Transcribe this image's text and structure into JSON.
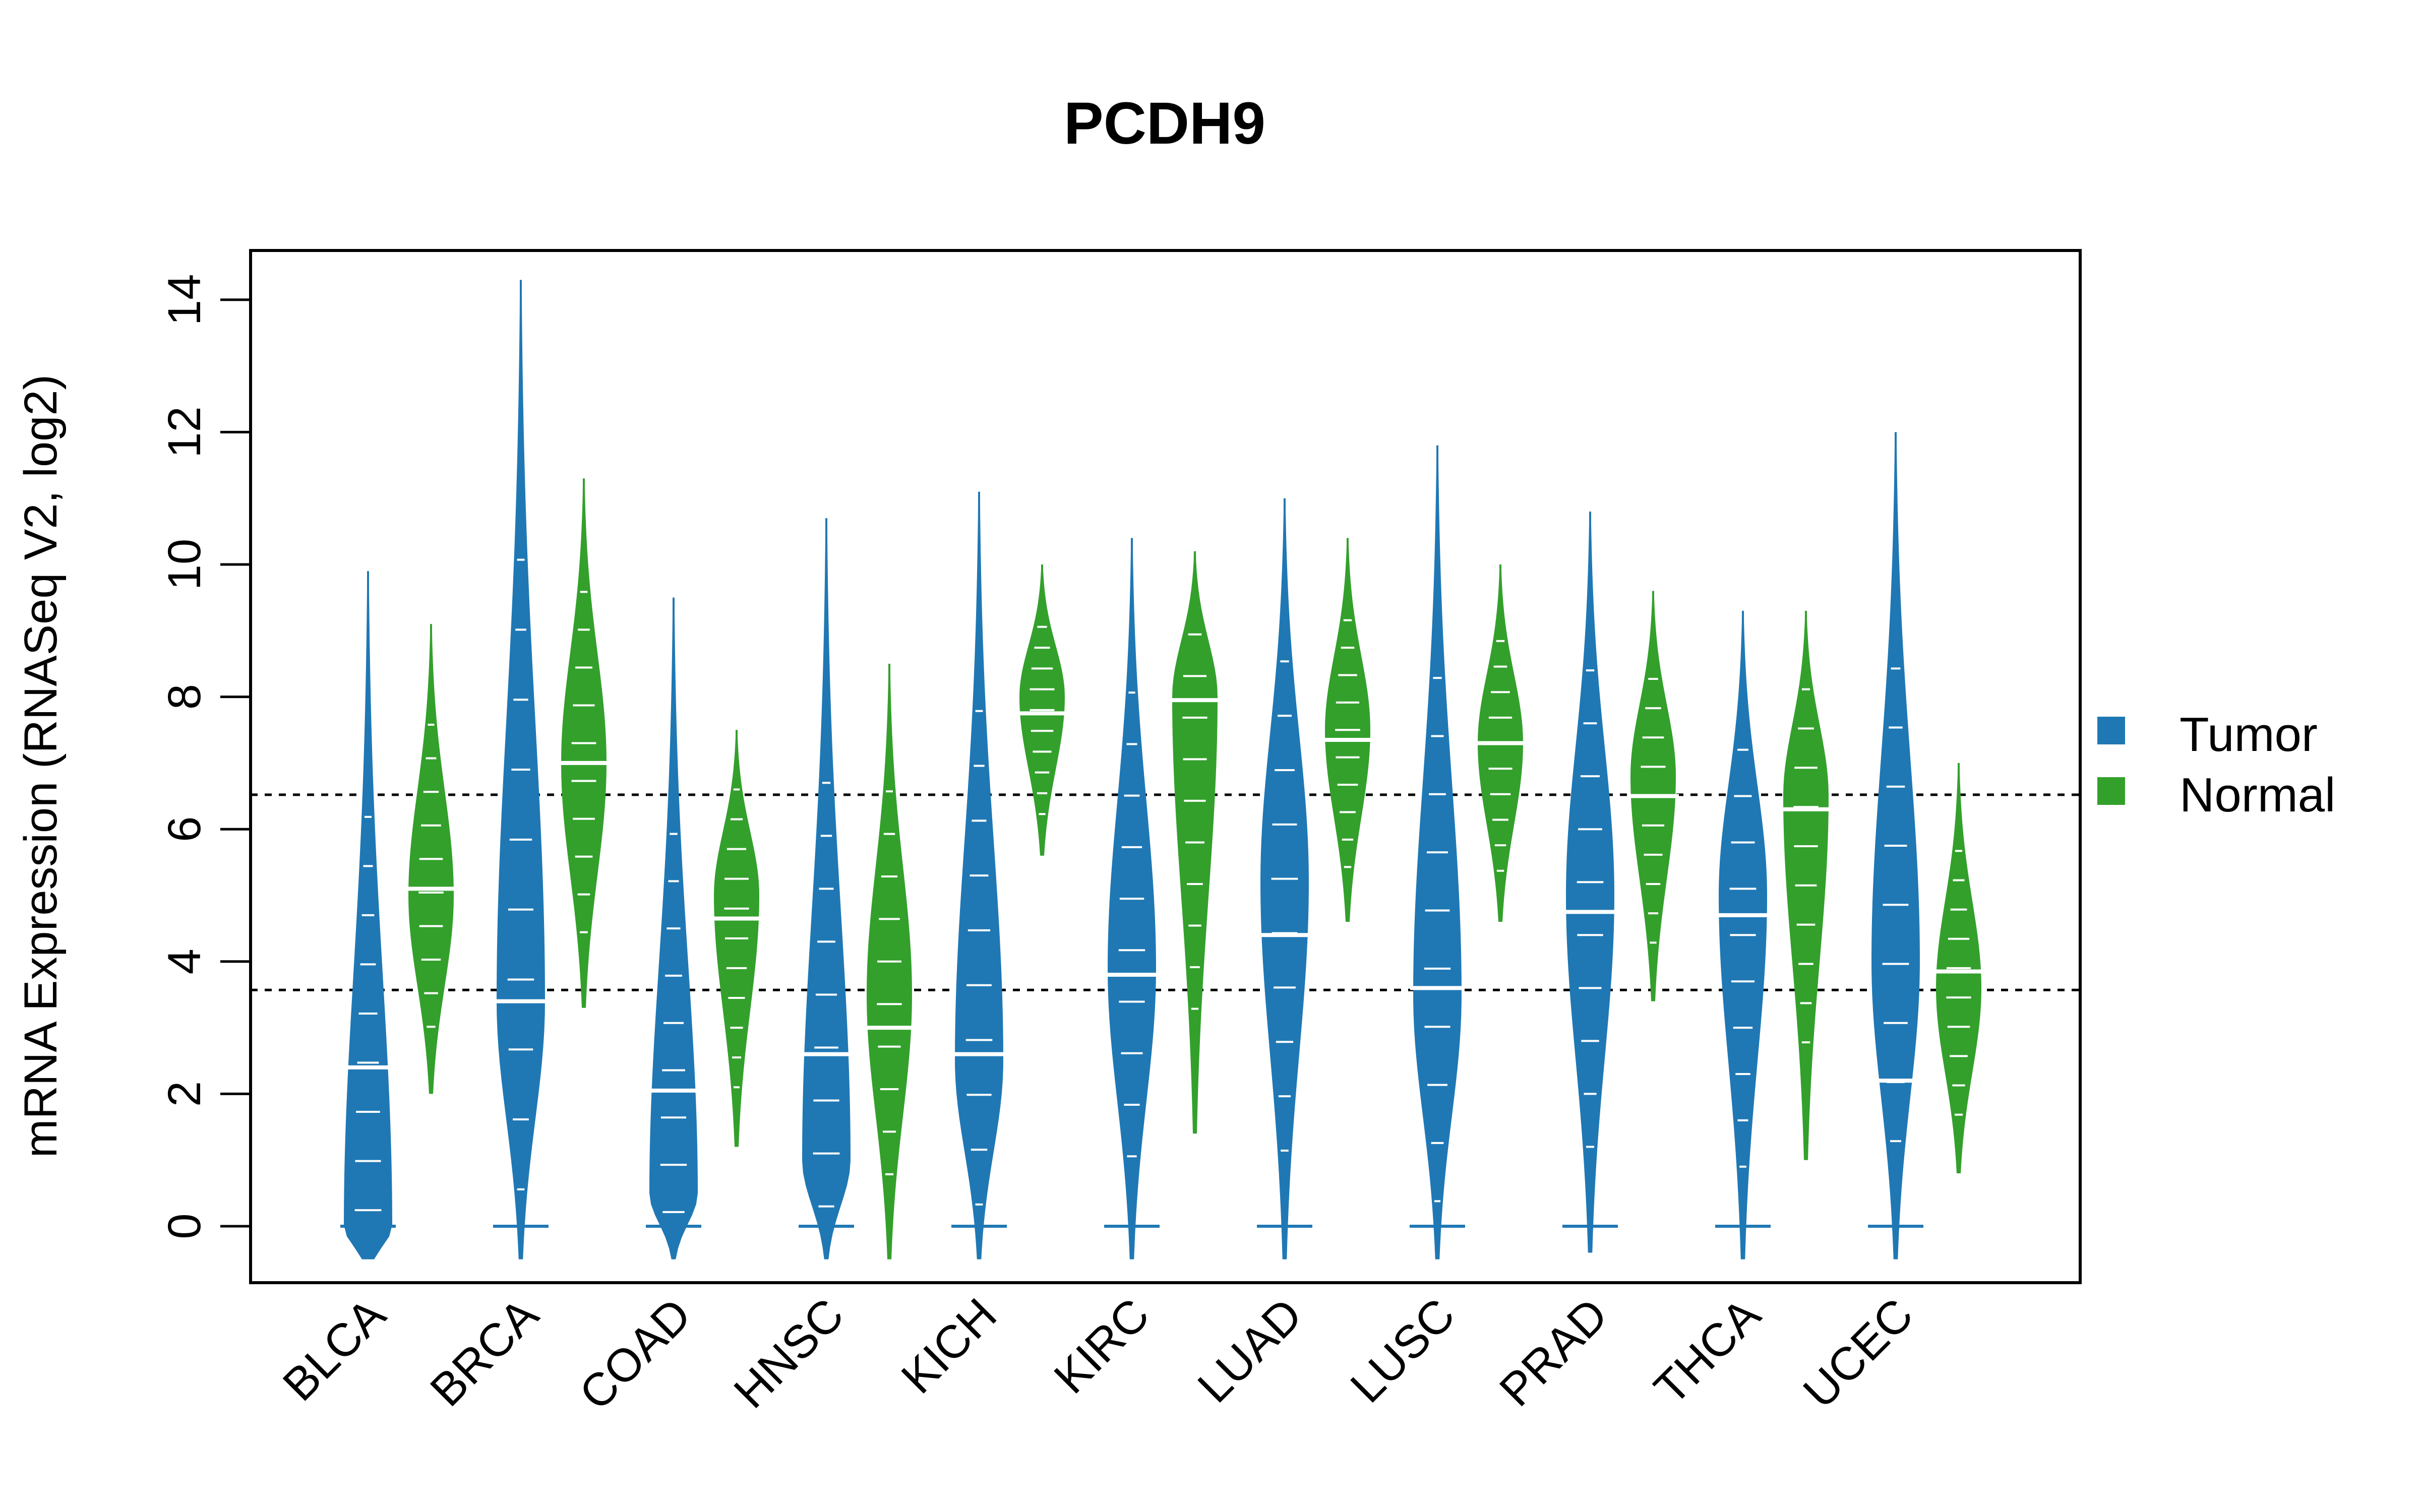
{
  "chart_data": {
    "type": "violin",
    "title": "PCDH9",
    "xlabel": "",
    "ylabel": "mRNA Expression (RNASeq V2, log2)",
    "ylim": [
      -0.6,
      14.8
    ],
    "yticks": [
      0,
      2,
      4,
      6,
      8,
      10,
      12,
      14
    ],
    "grid": false,
    "legend_position": "right",
    "reference_lines": [
      6.52,
      3.57
    ],
    "categories": [
      "BLCA",
      "BRCA",
      "COAD",
      "HNSC",
      "KICH",
      "KIRC",
      "LUAD",
      "LUSC",
      "PRAD",
      "THCA",
      "UCEC"
    ],
    "series": [
      {
        "name": "Tumor",
        "color": "#1f78b4",
        "medians": [
          2.4,
          3.4,
          2.05,
          2.6,
          2.6,
          3.8,
          4.4,
          3.6,
          4.75,
          4.7,
          2.2
        ],
        "mins": [
          -0.5,
          -0.5,
          -0.5,
          -0.5,
          -0.5,
          -0.5,
          -0.5,
          -0.5,
          -0.4,
          -0.5,
          -0.5
        ],
        "maxs": [
          9.9,
          14.3,
          9.5,
          10.7,
          11.1,
          10.4,
          11.0,
          11.8,
          10.8,
          9.3,
          12.0
        ],
        "modes": [
          0.0,
          3.4,
          0.5,
          1.0,
          2.5,
          3.9,
          5.2,
          3.5,
          5.0,
          5.0,
          4.0
        ]
      },
      {
        "name": "Normal",
        "color": "#33a02c",
        "medians": [
          5.1,
          7.0,
          4.65,
          3.0,
          7.75,
          7.95,
          7.35,
          7.3,
          6.5,
          6.3,
          3.85
        ],
        "mins": [
          2.0,
          3.3,
          1.2,
          -0.5,
          5.6,
          1.4,
          4.6,
          4.6,
          3.4,
          1.0,
          0.8
        ],
        "maxs": [
          9.1,
          11.3,
          7.5,
          8.5,
          10.0,
          10.2,
          10.4,
          10.0,
          9.6,
          9.3,
          7.0
        ],
        "modes": [
          5.0,
          7.0,
          5.0,
          3.5,
          8.0,
          8.0,
          7.5,
          7.3,
          6.8,
          6.5,
          3.6
        ]
      }
    ]
  },
  "legend": {
    "items": [
      {
        "label": "Tumor",
        "color": "#1f78b4"
      },
      {
        "label": "Normal",
        "color": "#33a02c"
      }
    ]
  }
}
